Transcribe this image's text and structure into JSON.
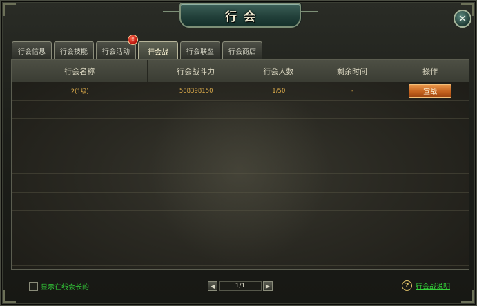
{
  "window": {
    "title": "行会",
    "close_icon": "close-icon"
  },
  "tabs": [
    {
      "label": "行会信息",
      "active": false
    },
    {
      "label": "行会技能",
      "active": false
    },
    {
      "label": "行会活动",
      "active": false,
      "alert": "!"
    },
    {
      "label": "行会战",
      "active": true
    },
    {
      "label": "行会联盟",
      "active": false
    },
    {
      "label": "行会商店",
      "active": false
    }
  ],
  "table": {
    "columns": [
      "行会名称",
      "行会战斗力",
      "行会人数",
      "剩余时间",
      "操作"
    ],
    "rows": [
      {
        "name": "2(1级)",
        "power": "588398150",
        "members": "1/50",
        "remaining": "-",
        "action": "宣战"
      }
    ]
  },
  "footer": {
    "show_online_label": "显示在线会长的",
    "pagination": "1/1",
    "help_label": "行会战说明"
  },
  "colors": {
    "accent_orange": "#c4621e",
    "link_green": "#34d23a",
    "value_gold": "#d9a94a"
  }
}
